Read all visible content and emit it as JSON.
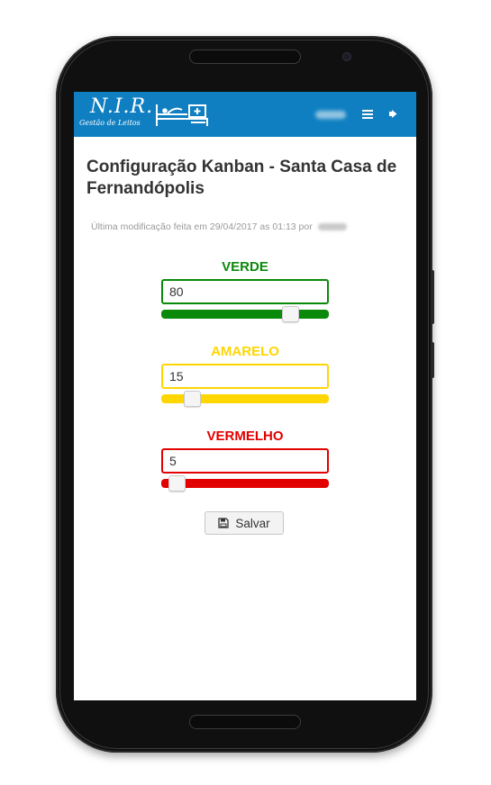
{
  "header": {
    "logo_title": "N.I.R.",
    "logo_subtitle": "Gestão de Leitos",
    "logo_icon": "hospital-bed-icon",
    "menu_icon": "hamburger-menu-icon",
    "logout_icon": "logout-icon"
  },
  "page": {
    "title": "Configuração Kanban - Santa Casa de Fernandópolis",
    "last_modified": "Última modificação feita em 29/04/2017 as 01:13 por"
  },
  "levels": [
    {
      "label": "VERDE",
      "value": "80",
      "slider_fraction": 0.8,
      "color": "#0a8a0a"
    },
    {
      "label": "AMARELO",
      "value": "15",
      "slider_fraction": 0.15,
      "color": "#ffd600"
    },
    {
      "label": "VERMELHO",
      "value": "5",
      "slider_fraction": 0.05,
      "color": "#e30000"
    }
  ],
  "actions": {
    "save_label": "Salvar",
    "save_icon": "floppy-disk-icon"
  },
  "colors": {
    "header_bg": "#0f7fc1",
    "title_text": "#333333"
  }
}
